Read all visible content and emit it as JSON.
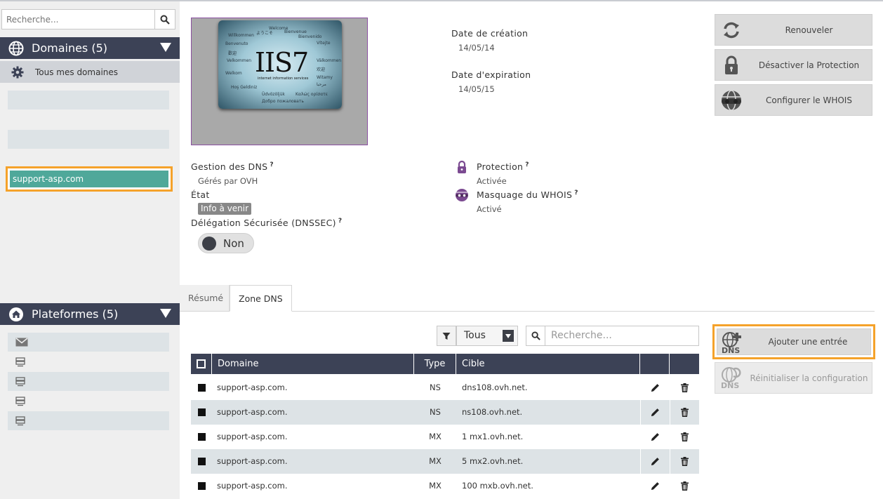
{
  "sidebar": {
    "search_placeholder": "Recherche...",
    "domains_header": "Domaines (5)",
    "all_domains": "Tous mes domaines",
    "selected_domain": "support-asp.com",
    "platforms_header": "Plateformes (5)"
  },
  "overview": {
    "thumbnail": {
      "title": "IIS7",
      "subtitle": "internet information services",
      "words": [
        "Welcome",
        "Bienvenue",
        "Willkommen",
        "Bienvenido",
        "Benvenuto",
        "Vítejte",
        "Velkommen",
        "Välkommen",
        "Welkom",
        "Hoş Geldiniz",
        "Witamy",
        "Üdvözöljük",
        "Καλώς ορίσατε",
        "Добро пожаловать",
        "歡迎",
        "欢迎",
        "مرحبا",
        "ようこそ"
      ]
    },
    "creation_label": "Date de création",
    "creation_value": "14/05/14",
    "expiration_label": "Date d'expiration",
    "expiration_value": "14/05/15",
    "dns_label": "Gestion des DNS",
    "dns_value": "Gérés par OVH",
    "state_label": "État",
    "state_badge": "Info à venir",
    "dnssec_label": "Délégation Sécurisée (DNSSEC)",
    "dnssec_toggle": "Non",
    "protection_label": "Protection",
    "protection_value": "Activée",
    "whois_label": "Masquage du WHOIS",
    "whois_value": "Activé",
    "help_mark": "?"
  },
  "actions": {
    "renew": "Renouveler",
    "disable_protection": "Désactiver la Protection",
    "configure_whois": "Configurer le WHOIS",
    "add_entry": "Ajouter une entrée",
    "reset_config": "Réinitialiser la configuration"
  },
  "tabs": [
    {
      "label": "Résumé"
    },
    {
      "label": "Zone DNS"
    }
  ],
  "filters": {
    "type_selected": "Tous",
    "search_placeholder": "Recherche..."
  },
  "table": {
    "headers": {
      "domain": "Domaine",
      "type": "Type",
      "target": "Cible"
    },
    "rows": [
      {
        "domain": "support-asp.com.",
        "type": "NS",
        "target": "dns108.ovh.net."
      },
      {
        "domain": "support-asp.com.",
        "type": "NS",
        "target": "ns108.ovh.net."
      },
      {
        "domain": "support-asp.com.",
        "type": "MX",
        "target": "1 mx1.ovh.net."
      },
      {
        "domain": "support-asp.com.",
        "type": "MX",
        "target": "5 mx2.ovh.net."
      },
      {
        "domain": "support-asp.com.",
        "type": "MX",
        "target": "100 mxb.ovh.net."
      }
    ]
  },
  "colors": {
    "header_bg": "#3c4256",
    "highlight": "#f5a22a",
    "selected_domain": "#4fa89a",
    "row_alt": "#dde3e6",
    "accent_purple": "#8a4fa0"
  }
}
